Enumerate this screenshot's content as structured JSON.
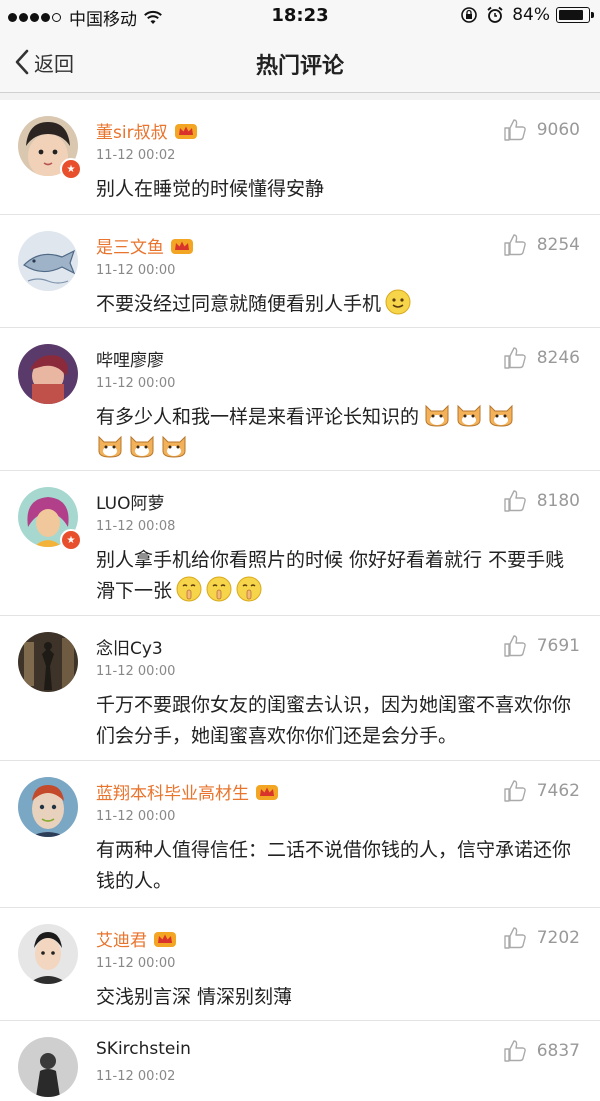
{
  "status_bar": {
    "carrier": "中国移动",
    "time": "18:23",
    "battery": "84%",
    "battery_level": 0.84,
    "icons": [
      "signal-dots-icon",
      "wifi-icon",
      "rotation-lock-icon",
      "alarm-icon",
      "battery-icon"
    ]
  },
  "nav": {
    "back_label": "返回",
    "title": "热门评论"
  },
  "colors": {
    "vip_name": "#e8742d",
    "plain_name": "#222222",
    "badge": "#e8502d"
  },
  "comments": [
    {
      "name": "董sir叔叔",
      "vip": true,
      "verified": true,
      "time": "11-12 00:02",
      "likes": "9060",
      "text": "别人在睡觉的时候懂得安静",
      "emojis": []
    },
    {
      "name": "是三文鱼",
      "vip": true,
      "verified": false,
      "time": "11-12 00:00",
      "likes": "8254",
      "text": "不要没经过同意就随便看别人手机",
      "emojis": [
        "smile-emoji"
      ]
    },
    {
      "name": "哔哩廖廖",
      "vip": false,
      "verified": false,
      "time": "11-12 00:00",
      "likes": "8246",
      "text": "有多少人和我一样是来看评论长知识的",
      "emojis": [
        "cat-emoji",
        "cat-emoji",
        "cat-emoji",
        "cat-emoji",
        "cat-emoji",
        "cat-emoji"
      ]
    },
    {
      "name": "LUO阿萝",
      "vip": false,
      "verified": true,
      "time": "11-12 00:08",
      "likes": "8180",
      "text": "别人拿手机给你看照片的时候 你好好看着就行 不要手贱滑下一张",
      "emojis": [
        "shush-emoji",
        "shush-emoji",
        "shush-emoji"
      ]
    },
    {
      "name": "念旧Cy3",
      "vip": false,
      "verified": false,
      "time": "11-12 00:00",
      "likes": "7691",
      "text": "千万不要跟你女友的闺蜜去认识，因为她闺蜜不喜欢你你们会分手，她闺蜜喜欢你你们还是会分手。",
      "emojis": []
    },
    {
      "name": "蓝翔本科毕业高材生",
      "vip": true,
      "verified": false,
      "time": "11-12 00:00",
      "likes": "7462",
      "text": "有两种人值得信任：二话不说借你钱的人，信守承诺还你钱的人。",
      "emojis": []
    },
    {
      "name": "艾迪君",
      "vip": true,
      "verified": false,
      "time": "11-12 00:00",
      "likes": "7202",
      "text": "交浅别言深 情深别刻薄",
      "emojis": []
    },
    {
      "name": "SKirchstein",
      "vip": false,
      "verified": false,
      "time": "11-12 00:02",
      "likes": "6837",
      "text": "",
      "emojis": []
    }
  ]
}
